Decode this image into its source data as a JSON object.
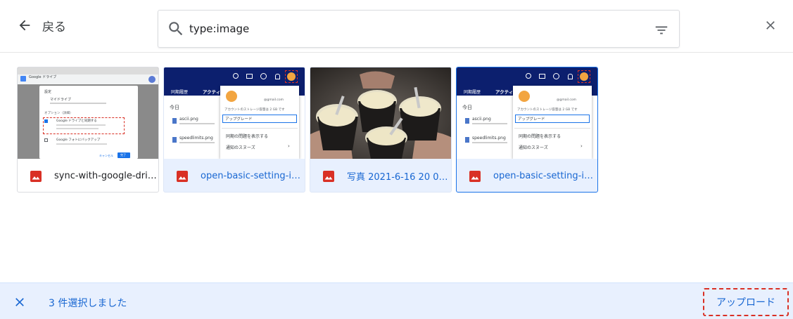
{
  "header": {
    "back_label": "戻る",
    "search": {
      "value": "type:image",
      "placeholder": ""
    }
  },
  "files": [
    {
      "name": "sync-with-google-driv...",
      "selected": false
    },
    {
      "name": "open-basic-setting-in-...",
      "selected": true
    },
    {
      "name": "写真 2021-6-16 20 08 ...",
      "selected": true
    },
    {
      "name": "open-basic-setting-in-...",
      "selected": true
    }
  ],
  "thumb_sync": {
    "title": "Google ドライブ",
    "settings": "設定",
    "mydrive": "マイドライブ",
    "options": "オプション（詳細）",
    "option1": "Google ドライブと同期する",
    "option2": "Google フォトにバックアップ",
    "cancel": "キャンセル",
    "done": "完了"
  },
  "thumb_menu": {
    "tab1": "同期履歴",
    "tab2": "アクティ",
    "today": "今日",
    "file1": "ascii.png",
    "file2": "speedlimits.png",
    "email": "@gmail.com",
    "storage": "アカウントのストレージ容量は 2 GB です",
    "upgrade": "アップグレード",
    "show_issues": "同期の問題を表示する",
    "notif": "通知のスヌーズ"
  },
  "selection": {
    "count_label": "3 件選択しました"
  },
  "actions": {
    "upload_label": "アップロード"
  },
  "colors": {
    "accent": "#1967d2",
    "selected_bg": "#e8f0fe",
    "image_icon": "#d93025",
    "dark_nav": "#0c1f6e"
  }
}
